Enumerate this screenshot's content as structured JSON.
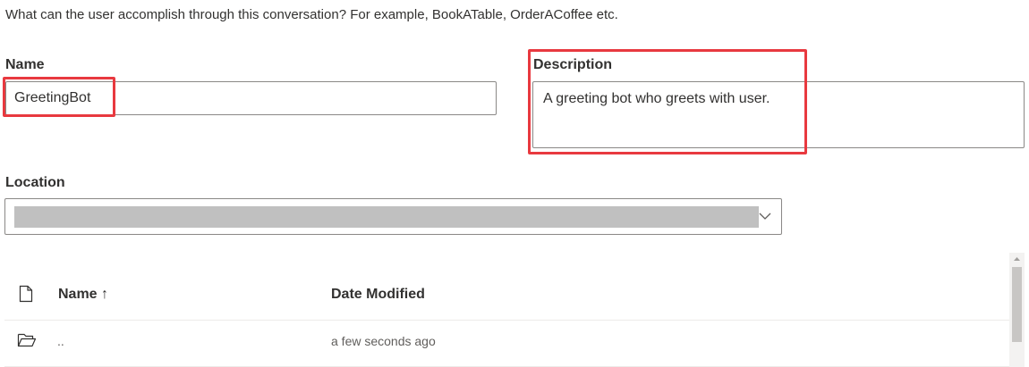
{
  "intro_text": "What can the user accomplish through this conversation? For example, BookATable, OrderACoffee etc.",
  "name_field": {
    "label": "Name",
    "value": "GreetingBot"
  },
  "description_field": {
    "label": "Description",
    "value": "A greeting bot who greets with user."
  },
  "location_field": {
    "label": "Location",
    "value": ""
  },
  "file_table": {
    "columns": {
      "name": "Name ↑",
      "date_modified": "Date Modified"
    },
    "rows": [
      {
        "name": "..",
        "date_modified": "a few seconds ago"
      }
    ]
  },
  "colors": {
    "highlight": "#e8393f",
    "border": "#8a8886",
    "text": "#323130"
  }
}
